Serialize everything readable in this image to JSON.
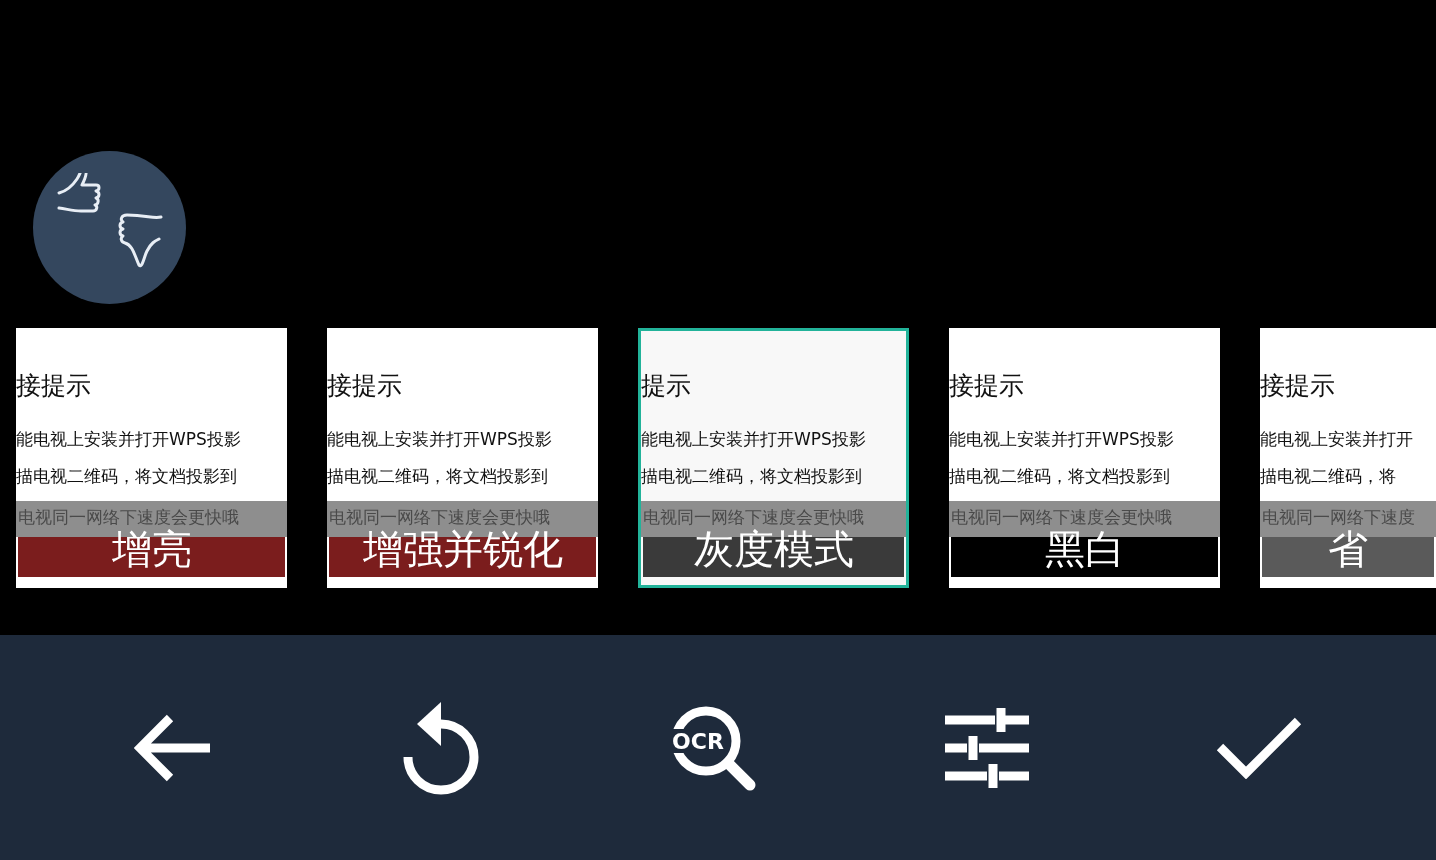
{
  "feedback_button": {
    "kind": "thumbs"
  },
  "filters": [
    {
      "label": "增亮",
      "selected": false,
      "color": "#7b1d1d",
      "doc_title": "接提示",
      "doc_lines": [
        "能电视上安装并打开WPS投影",
        "描电视二维码，将文档投影到"
      ],
      "doc_note": "电视同一网络下速度会更快哦"
    },
    {
      "label": "增强并锐化",
      "selected": false,
      "color": "#7b1d1d",
      "doc_title": "接提示",
      "doc_lines": [
        "能电视上安装并打开WPS投影",
        "描电视二维码，将文档投影到"
      ],
      "doc_note": "电视同一网络下速度会更快哦"
    },
    {
      "label": "灰度模式",
      "selected": true,
      "color": "#3a3a3a",
      "doc_title": "提示",
      "doc_lines": [
        "能电视上安装并打开WPS投影",
        "描电视二维码，将文档投影到"
      ],
      "doc_note": "电视同一网络下速度会更快哦"
    },
    {
      "label": "黑白",
      "selected": false,
      "color": "#000000",
      "doc_title": "接提示",
      "doc_lines": [
        "能电视上安装并打开WPS投影",
        "描电视二维码，将文档投影到"
      ],
      "doc_note": "电视同一网络下速度会更快哦"
    },
    {
      "label": "省",
      "selected": false,
      "color": "#5a5a5a",
      "doc_title": "接提示",
      "doc_lines": [
        "能电视上安装并打开",
        "描电视二维码，将"
      ],
      "doc_note": "电视同一网络下速度"
    }
  ],
  "toolbar": [
    {
      "kind": "back"
    },
    {
      "kind": "rotate"
    },
    {
      "kind": "ocr",
      "text": "OCR"
    },
    {
      "kind": "adjust"
    },
    {
      "kind": "confirm"
    }
  ]
}
